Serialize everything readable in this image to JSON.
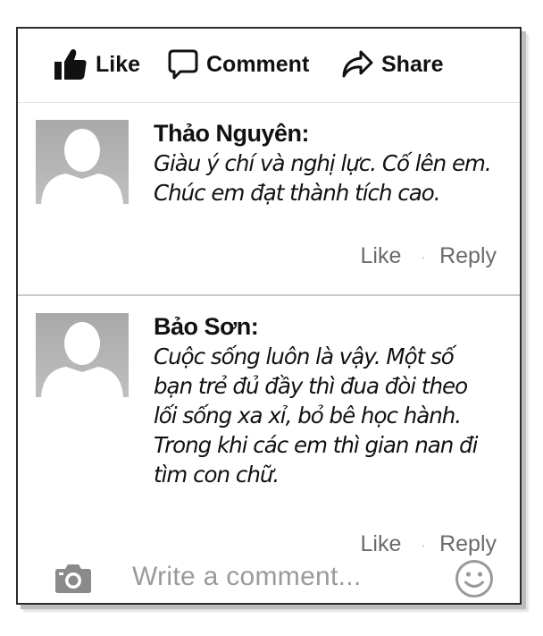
{
  "actions": {
    "like_label": "Like",
    "comment_label": "Comment",
    "share_label": "Share"
  },
  "comments": [
    {
      "author": "Thảo Nguyên:",
      "text_lines": [
        "Giàu ý chí và nghị lực. Cố lên em.",
        "Chúc em đạt thành tích cao."
      ],
      "like_label": "Like",
      "reply_label": "Reply",
      "separator": "·"
    },
    {
      "author": "Bảo Sơn:",
      "text_lines": [
        "Cuộc sống luôn là vậy. Một số",
        "bạn trẻ đủ đầy thì đua đòi theo",
        "lối sống xa xỉ, bỏ bê học hành.",
        "Trong khi các em thì gian nan đi",
        "tìm con chữ."
      ],
      "like_label": "Like",
      "reply_label": "Reply",
      "separator": "·"
    }
  ],
  "composer": {
    "placeholder": "Write a comment...",
    "camera_icon": "camera-icon",
    "emoji_icon": "smiley-icon"
  },
  "colors": {
    "text": "#111111",
    "muted": "#6a6a6a",
    "placeholder": "#9a9a9a",
    "avatar_bg": "#b3b3b3"
  }
}
